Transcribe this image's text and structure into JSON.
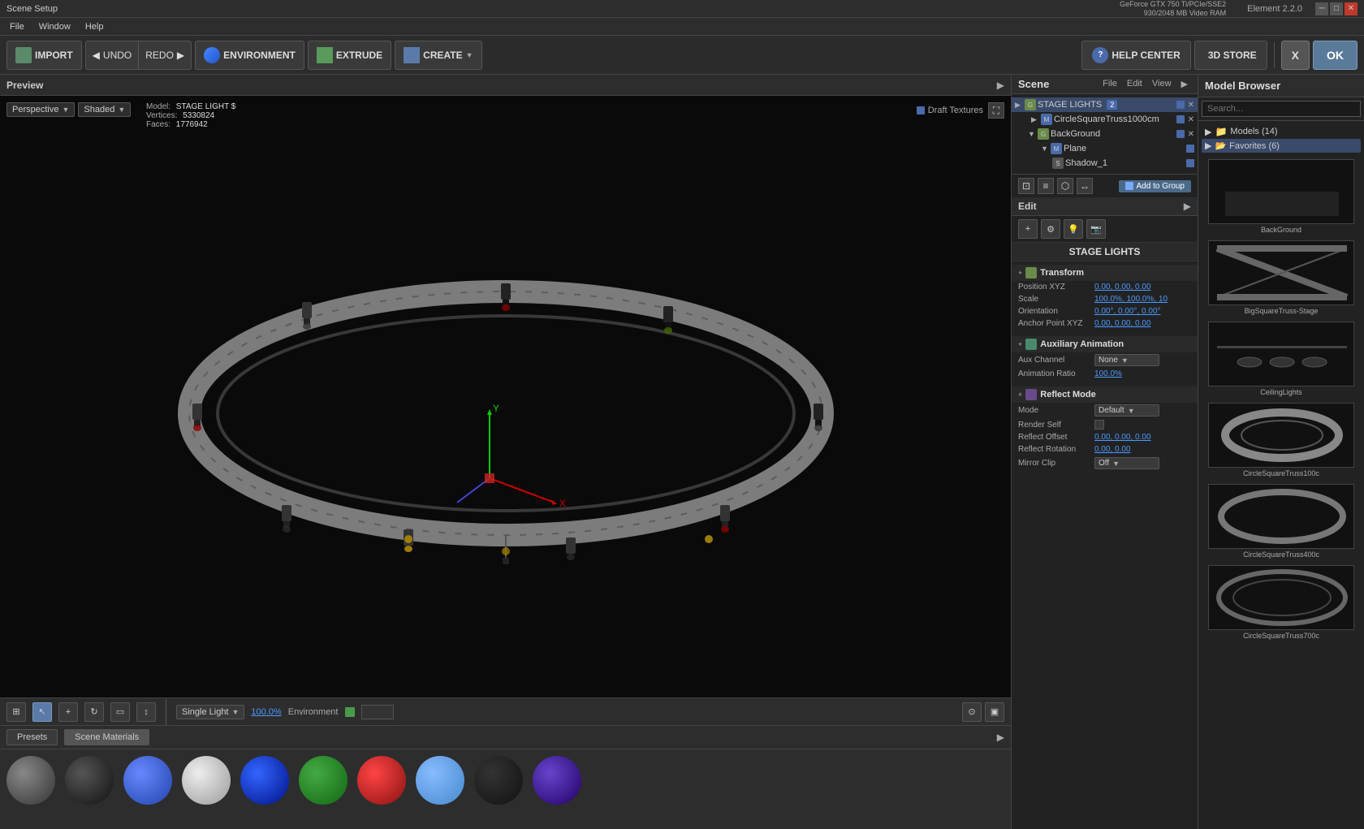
{
  "window": {
    "title": "Scene Setup",
    "gpu_info_line1": "GeForce GTX 750 Ti/PCIe/SSE2",
    "gpu_info_line2": "930/2048 MB Video RAM",
    "element_version": "Element 2.2.0"
  },
  "menubar": {
    "items": [
      "File",
      "Window",
      "Help"
    ]
  },
  "toolbar": {
    "import_label": "IMPORT",
    "undo_label": "UNDO",
    "redo_label": "REDO",
    "environment_label": "ENVIRONMENT",
    "extrude_label": "EXTRUDE",
    "create_label": "CREATE",
    "help_center_label": "HELP CENTER",
    "store_label": "3D STORE",
    "x_label": "X",
    "ok_label": "OK"
  },
  "viewport": {
    "preview_label": "Preview",
    "perspective_label": "Perspective",
    "shaded_label": "Shaded",
    "model_label": "Model:",
    "model_name": "STAGE LIGHT $",
    "vertices_label": "Vertices:",
    "vertices_value": "5330824",
    "faces_label": "Faces:",
    "faces_value": "1776942",
    "draft_textures_label": "Draft Textures",
    "single_light_label": "Single Light",
    "zoom_value": "100.0%",
    "environment_label": "Environment"
  },
  "materials": {
    "presets_tab": "Presets",
    "scene_materials_tab": "Scene Materials"
  },
  "scene_panel": {
    "title": "Scene",
    "menu_items": [
      "File",
      "Edit",
      "View"
    ],
    "tree": [
      {
        "id": "stage_lights",
        "label": "STAGE LIGHTS",
        "level": 0,
        "type": "group",
        "badge": "2",
        "expanded": true
      },
      {
        "id": "circle_truss",
        "label": "CircleSquareTruss1000cm",
        "level": 1,
        "type": "mesh",
        "expanded": false
      },
      {
        "id": "background",
        "label": "BackGround",
        "level": 1,
        "type": "group",
        "expanded": true
      },
      {
        "id": "plane",
        "label": "Plane",
        "level": 2,
        "type": "mesh"
      },
      {
        "id": "shadow_1",
        "label": "Shadow_1",
        "level": 3,
        "type": "shadow"
      }
    ],
    "add_to_group_label": "Add to Group"
  },
  "properties": {
    "edit_label": "Edit",
    "group_name": "STAGE LIGHTS",
    "sections": {
      "transform": {
        "title": "Transform",
        "position_label": "Position XYZ",
        "position_value": "0.00,  0.00,  0.00",
        "scale_label": "Scale",
        "scale_value": "100.0%,  100.0%,  10",
        "orientation_label": "Orientation",
        "orientation_value": "0.00°,  0.00°,  0.00°",
        "anchor_label": "Anchor Point XYZ",
        "anchor_value": "0.00,  0.00,  0.00"
      },
      "aux_animation": {
        "title": "Auxiliary Animation",
        "channel_label": "Aux Channel",
        "channel_value": "None",
        "ratio_label": "Animation Ratio",
        "ratio_value": "100.0%"
      },
      "reflect_mode": {
        "title": "Reflect Mode",
        "mode_label": "Mode",
        "mode_value": "Default",
        "render_self_label": "Render Self",
        "offset_label": "Reflect Offset",
        "offset_value": "0.00,  0.00,  0.00",
        "rotation_label": "Reflect Rotation",
        "rotation_value": "0.00,  0.00",
        "mirror_clip_label": "Mirror Clip",
        "mirror_clip_value": "Off"
      }
    }
  },
  "model_browser": {
    "title": "Model Browser",
    "search_placeholder": "Search...",
    "tree": [
      {
        "label": "Models (14)",
        "expanded": true
      },
      {
        "label": "Favorites (6)",
        "expanded": false,
        "selected": true
      }
    ],
    "thumbnails": [
      {
        "label": "BackGround"
      },
      {
        "label": "BigSquareTruss-Stage"
      },
      {
        "label": "CeilingLights"
      },
      {
        "label": "CircleSquareTruss100c"
      },
      {
        "label": "CircleSquareTruss400c"
      },
      {
        "label": "CircleSquareTruss700c"
      }
    ]
  }
}
